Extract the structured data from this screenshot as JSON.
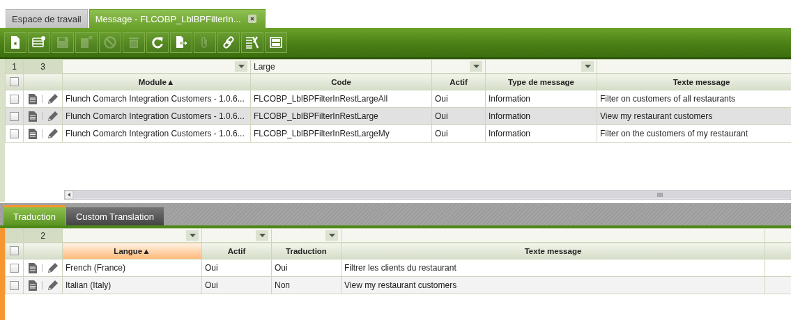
{
  "main_tabs": [
    {
      "label": "Espace de travail",
      "selected": false,
      "closable": false
    },
    {
      "label": "Message - FLCOBP_LblBPFilterIn...",
      "selected": true,
      "closable": true
    }
  ],
  "toolbar": [
    {
      "kind": "new",
      "disabled": false
    },
    {
      "kind": "form",
      "disabled": false
    },
    {
      "kind": "save",
      "disabled": true
    },
    {
      "kind": "delete",
      "disabled": true
    },
    {
      "kind": "cancel",
      "disabled": true
    },
    {
      "kind": "trash",
      "disabled": true
    },
    {
      "kind": "refresh",
      "disabled": false
    },
    {
      "kind": "export",
      "disabled": false
    },
    {
      "kind": "attach",
      "disabled": true
    },
    {
      "kind": "link",
      "disabled": false
    },
    {
      "kind": "tools",
      "disabled": false
    },
    {
      "kind": "layout",
      "disabled": false
    }
  ],
  "top_grid": {
    "selected_count": "1",
    "row_count": "3",
    "header_checked": false,
    "filters": [
      {
        "dropdown": true
      },
      {
        "dropdown": false,
        "value": "Large"
      },
      {
        "dropdown": true
      },
      {
        "dropdown": true
      },
      {
        "dropdown": false
      }
    ],
    "columns": [
      {
        "label": "Module",
        "sort_mark": "▲",
        "highlighted": false
      },
      {
        "label": "Code",
        "highlighted": false
      },
      {
        "label": "Actif",
        "highlighted": false
      },
      {
        "label": "Type de message",
        "highlighted": false
      },
      {
        "label": "Texte message",
        "highlighted": false
      }
    ],
    "rows": [
      {
        "checked": false,
        "selected": false,
        "cells": [
          "Flunch Comarch Integration Customers - 1.0.6...",
          "FLCOBP_LblBPFilterInRestLargeAll",
          "Oui",
          "Information",
          "Filter on customers of all restaurants"
        ]
      },
      {
        "checked": false,
        "selected": true,
        "cells": [
          "Flunch Comarch Integration Customers - 1.0.6...",
          "FLCOBP_LblBPFilterInRestLarge",
          "Oui",
          "Information",
          "View my restaurant customers"
        ]
      },
      {
        "checked": false,
        "selected": false,
        "cells": [
          "Flunch Comarch Integration Customers - 1.0.6...",
          "FLCOBP_LblBPFilterInRestLargeMy",
          "Oui",
          "Information",
          "Filter on the customers of my restaurant"
        ]
      }
    ]
  },
  "sub_tabs": [
    {
      "label": "Traduction",
      "selected": true
    },
    {
      "label": "Custom Translation",
      "selected": false
    }
  ],
  "bottom_grid": {
    "row_count": "2",
    "header_checked": false,
    "filters": [
      {
        "dropdown": true
      },
      {
        "dropdown": true
      },
      {
        "dropdown": true
      },
      {
        "dropdown": false
      },
      {
        "dropdown": false
      }
    ],
    "columns": [
      {
        "label": "Langue",
        "sort_mark": "▲",
        "highlighted": true
      },
      {
        "label": "Actif",
        "highlighted": false
      },
      {
        "label": "Traduction",
        "highlighted": false
      },
      {
        "label": "Texte message",
        "highlighted": false
      },
      {
        "highlighted": false
      }
    ],
    "rows": [
      {
        "checked": false,
        "selected": false,
        "cells": [
          "French (France)",
          "Oui",
          "Oui",
          "Filtrer les clients du restaurant"
        ]
      },
      {
        "checked": false,
        "selected": false,
        "cells": [
          "Italian (Italy)",
          "Oui",
          "Non",
          "View my restaurant customers"
        ]
      }
    ]
  }
}
